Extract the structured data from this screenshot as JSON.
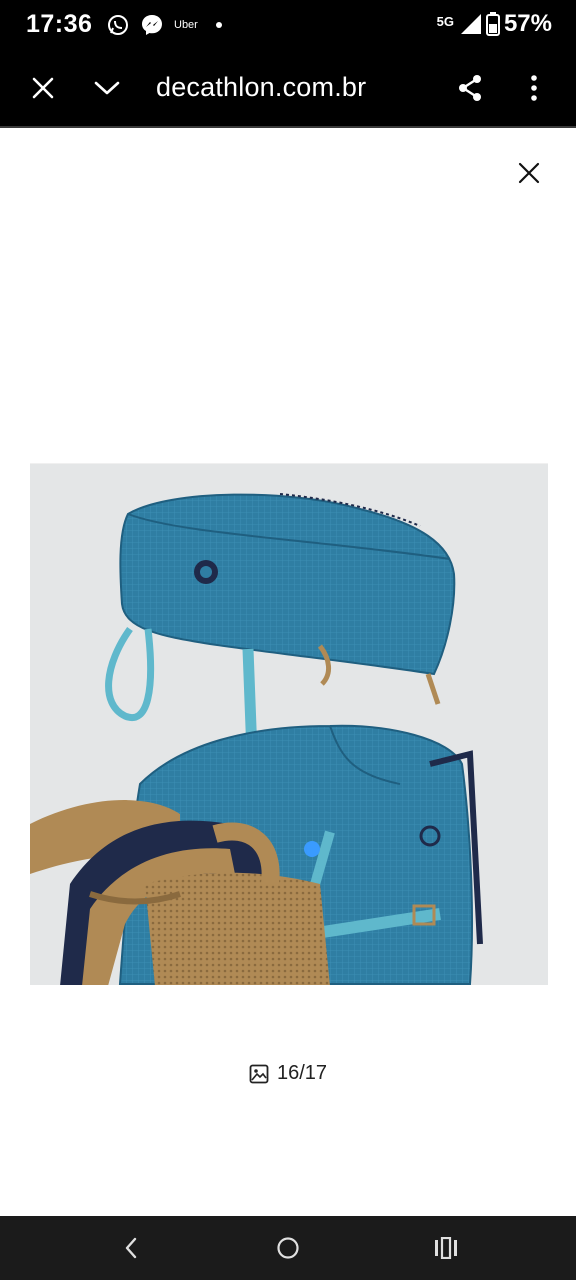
{
  "status_bar": {
    "time": "17:36",
    "notification_icons": [
      "whatsapp-icon",
      "messenger-icon",
      "uber-icon"
    ],
    "uber_label": "Uber",
    "network": "5G",
    "battery": "57%"
  },
  "toolbar": {
    "domain": "decathlon.com.br",
    "icons": [
      "close-icon",
      "chevron-down-icon",
      "share-icon",
      "more-vert-icon"
    ]
  },
  "viewer": {
    "close_icon": "close-icon",
    "image_counter": "16/17",
    "image_counter_icon": "image-icon"
  },
  "colors": {
    "bar_background": "#000000",
    "page_background": "#ffffff",
    "image_background": "#e4e6e7",
    "backpack_blue": "#2f7ea3",
    "strap_tan": "#b08a55",
    "navy": "#1f2a4a",
    "light_strap": "#5fb8cc"
  },
  "nav_bar": {
    "buttons": [
      "back-icon",
      "home-icon",
      "recents-icon"
    ]
  }
}
